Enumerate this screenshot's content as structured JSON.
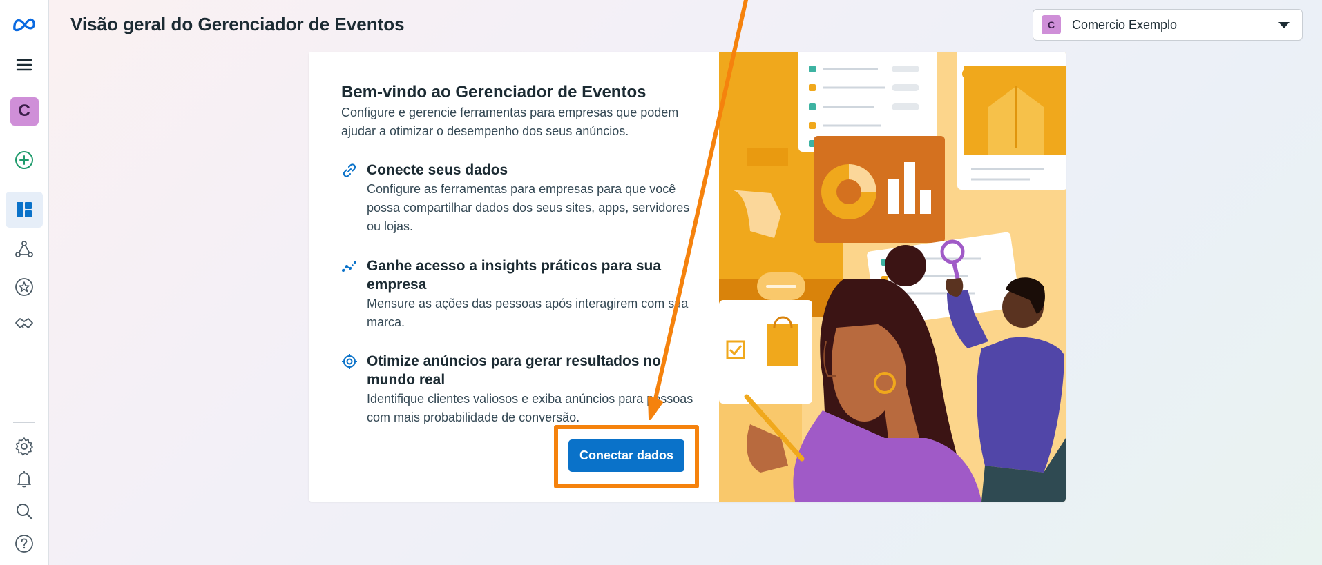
{
  "header": {
    "title": "Visão geral do Gerenciador de Eventos"
  },
  "account": {
    "initial": "C",
    "name": "Comercio Exemplo"
  },
  "sidebar": {
    "profile_initial": "C",
    "items": [
      {
        "icon": "meta-logo-icon"
      },
      {
        "icon": "menu-icon"
      },
      {
        "icon": "add-icon"
      },
      {
        "icon": "overview-icon",
        "active": true
      },
      {
        "icon": "data-sources-icon"
      },
      {
        "icon": "star-icon"
      },
      {
        "icon": "partner-integrations-icon"
      },
      {
        "icon": "gear-icon"
      },
      {
        "icon": "bell-icon"
      },
      {
        "icon": "search-icon"
      },
      {
        "icon": "help-icon"
      }
    ]
  },
  "card": {
    "title": "Bem-vindo ao Gerenciador de Eventos",
    "description": "Configure e gerencie ferramentas para empresas que podem ajudar a otimizar o desempenho dos seus anúncios.",
    "features": [
      {
        "icon": "link-icon",
        "title": "Conecte seus dados",
        "description": "Configure as ferramentas para empresas para que você possa compartilhar dados dos seus sites, apps, servidores ou lojas."
      },
      {
        "icon": "insights-icon",
        "title": "Ganhe acesso a insights práticos para sua empresa",
        "description": "Mensure as ações das pessoas após interagirem com sua marca."
      },
      {
        "icon": "target-icon",
        "title": "Otimize anúncios para gerar resultados no mundo real",
        "description": "Identifique clientes valiosos e exiba anúncios para pessoas com mais probabilidade de conversão."
      }
    ],
    "button_label": "Conectar dados"
  },
  "colors": {
    "primary": "#0a72c9",
    "highlight": "#f5820d",
    "avatar": "#cf8fd8"
  }
}
